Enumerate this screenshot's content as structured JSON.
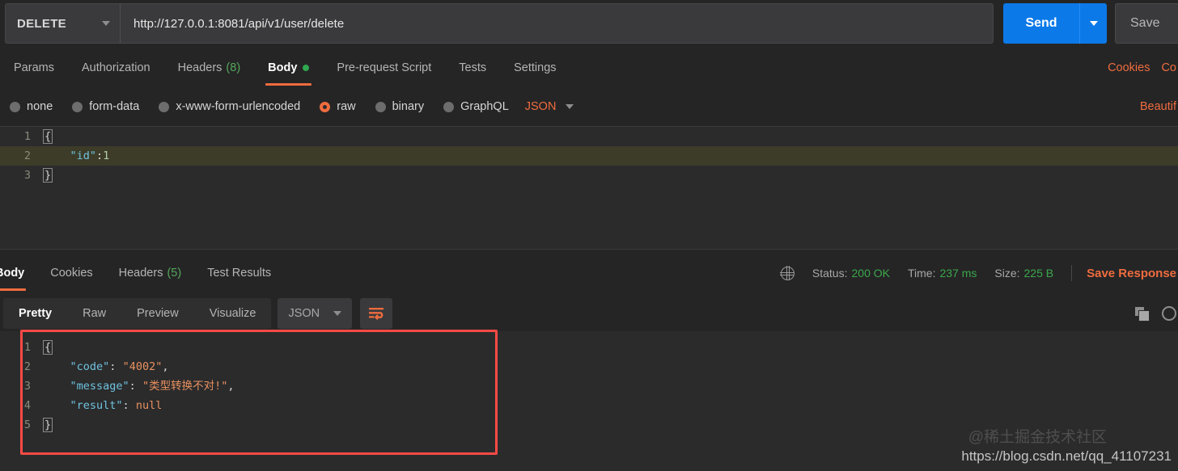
{
  "request": {
    "method": "DELETE",
    "url": "http://127.0.0.1:8081/api/v1/user/delete",
    "send_label": "Send",
    "save_label": "Save",
    "tabs": [
      {
        "label": "Params",
        "count": null,
        "active": false
      },
      {
        "label": "Authorization",
        "count": null,
        "active": false
      },
      {
        "label": "Headers",
        "count": "(8)",
        "active": false
      },
      {
        "label": "Body",
        "count": null,
        "active": true
      },
      {
        "label": "Pre-request Script",
        "count": null,
        "active": false
      },
      {
        "label": "Tests",
        "count": null,
        "active": false
      },
      {
        "label": "Settings",
        "count": null,
        "active": false
      }
    ],
    "header_links": [
      "Cookies",
      "Co"
    ],
    "body_types": [
      {
        "label": "none",
        "selected": false
      },
      {
        "label": "form-data",
        "selected": false
      },
      {
        "label": "x-www-form-urlencoded",
        "selected": false
      },
      {
        "label": "raw",
        "selected": true
      },
      {
        "label": "binary",
        "selected": false
      },
      {
        "label": "GraphQL",
        "selected": false
      }
    ],
    "format": "JSON",
    "beautify_label": "Beautif",
    "body_lines": [
      {
        "n": "1",
        "parts": [
          {
            "t": "{",
            "c": "brace"
          }
        ],
        "highlight": false
      },
      {
        "n": "2",
        "parts": [
          {
            "t": "    ",
            "c": "punc"
          },
          {
            "t": "\"id\"",
            "c": "key"
          },
          {
            "t": ":",
            "c": "punc"
          },
          {
            "t": "1",
            "c": "num"
          }
        ],
        "highlight": true
      },
      {
        "n": "3",
        "parts": [
          {
            "t": "}",
            "c": "brace"
          }
        ],
        "highlight": false
      }
    ]
  },
  "response": {
    "tabs": [
      {
        "label": "Body",
        "count": null,
        "active": true
      },
      {
        "label": "Cookies",
        "count": null,
        "active": false
      },
      {
        "label": "Headers",
        "count": "(5)",
        "active": false
      },
      {
        "label": "Test Results",
        "count": null,
        "active": false
      }
    ],
    "status_label": "Status:",
    "status_value": "200 OK",
    "time_label": "Time:",
    "time_value": "237 ms",
    "size_label": "Size:",
    "size_value": "225 B",
    "save_response_label": "Save Response",
    "view_tabs": [
      {
        "label": "Pretty",
        "active": true
      },
      {
        "label": "Raw",
        "active": false
      },
      {
        "label": "Preview",
        "active": false
      },
      {
        "label": "Visualize",
        "active": false
      }
    ],
    "format": "JSON",
    "body_lines": [
      {
        "n": "1",
        "parts": [
          {
            "t": "{",
            "c": "brace"
          }
        ]
      },
      {
        "n": "2",
        "parts": [
          {
            "t": "    ",
            "c": "punc"
          },
          {
            "t": "\"code\"",
            "c": "key"
          },
          {
            "t": ": ",
            "c": "punc"
          },
          {
            "t": "\"4002\"",
            "c": "str"
          },
          {
            "t": ",",
            "c": "punc"
          }
        ]
      },
      {
        "n": "3",
        "parts": [
          {
            "t": "    ",
            "c": "punc"
          },
          {
            "t": "\"message\"",
            "c": "key"
          },
          {
            "t": ": ",
            "c": "punc"
          },
          {
            "t": "\"类型转换不对!\"",
            "c": "str"
          },
          {
            "t": ",",
            "c": "punc"
          }
        ]
      },
      {
        "n": "4",
        "parts": [
          {
            "t": "    ",
            "c": "punc"
          },
          {
            "t": "\"result\"",
            "c": "key"
          },
          {
            "t": ": ",
            "c": "punc"
          },
          {
            "t": "null",
            "c": "null"
          }
        ]
      },
      {
        "n": "5",
        "parts": [
          {
            "t": "}",
            "c": "brace"
          }
        ]
      }
    ]
  },
  "watermarks": {
    "community": "@稀土掘金技术社区",
    "blog": "https://blog.csdn.net/qq_41107231"
  },
  "colors": {
    "accent_orange": "#ef6c3e",
    "send_blue": "#0b79e8",
    "status_green": "#3ba84a",
    "annotation_red": "#fb4a45"
  }
}
